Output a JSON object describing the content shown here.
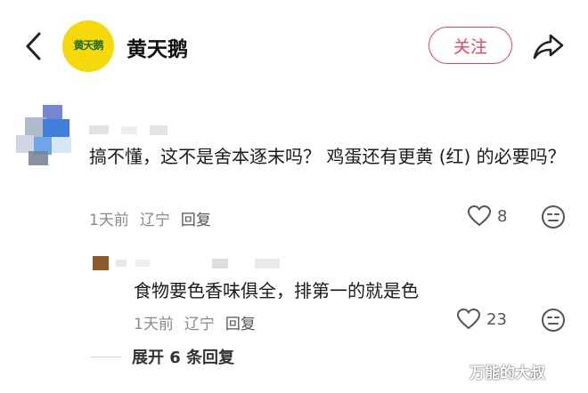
{
  "header": {
    "logo_text": "黄天鹅",
    "account_name": "黄天鹅",
    "follow_label": "关注"
  },
  "comment": {
    "text": "搞不懂，这不是舍本逐末吗？ 鸡蛋还有更黄 (红) 的必要吗？",
    "time": "1天前",
    "location": "辽宁",
    "reply_label": "回复",
    "likes": "8"
  },
  "reply": {
    "text": "食物要色香味俱全，排第一的就是色",
    "time": "1天前",
    "location": "辽宁",
    "reply_label": "回复",
    "likes": "23"
  },
  "expand_label": "展开 6 条回复",
  "watermark": "万能的大叔",
  "colors": {
    "accent": "#e8455a",
    "logo_bg": "#f5d90a"
  },
  "icons": [
    "back-icon",
    "share-icon",
    "heart-icon",
    "emoji-icon"
  ]
}
